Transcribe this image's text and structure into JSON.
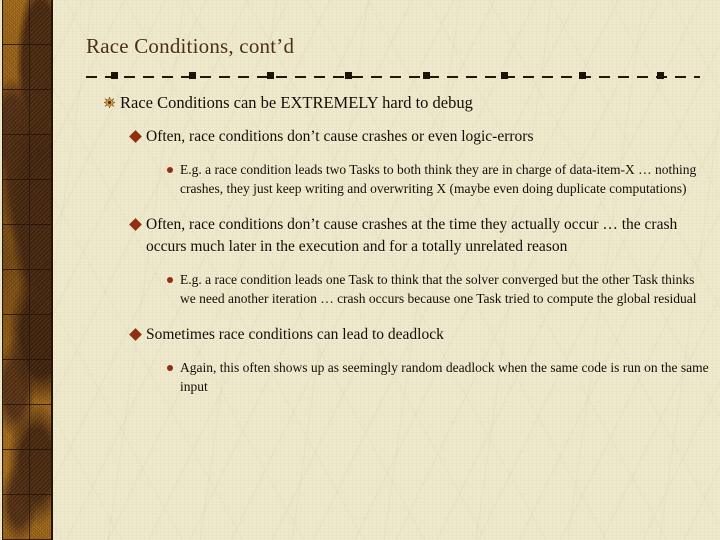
{
  "slide": {
    "title": "Race Conditions, cont’d",
    "background_color": "#ece7c9",
    "title_color": "#4a2f14",
    "body_text_color": "#130b04",
    "accent_color": "#8f3110",
    "band_color": "#a96f1d",
    "rule_color": "#241608"
  },
  "sidebar": {
    "name": "decorative-left-band"
  },
  "bullets": [
    {
      "level": 1,
      "glyph": "star-bullet-icon",
      "text": "Race Conditions can be EXTREMELY hard to debug"
    },
    {
      "level": 2,
      "glyph": "diamond-bullet-icon",
      "text": "Often, race conditions don’t cause crashes or even logic-errors"
    },
    {
      "level": 3,
      "glyph": "dot-bullet-icon",
      "text": "E.g. a race condition leads two Tasks to both think they are in charge of data-item-X … nothing crashes, they just keep writing and overwriting X (maybe even doing duplicate computations)"
    },
    {
      "level": 2,
      "glyph": "diamond-bullet-icon",
      "text": "Often, race conditions don’t cause crashes at the time they actually occur … the crash occurs much later in the execution and for a totally unrelated reason"
    },
    {
      "level": 3,
      "glyph": "dot-bullet-icon",
      "text": "E.g. a race condition leads one Task to think that the solver converged but the other Task thinks we need another iteration … crash occurs because one Task tried to compute the global residual"
    },
    {
      "level": 2,
      "glyph": "diamond-bullet-icon",
      "text": "Sometimes race conditions can lead to deadlock"
    },
    {
      "level": 3,
      "glyph": "dot-bullet-icon",
      "text": "Again, this often shows up as seemingly random deadlock when the same code is run on the same input"
    }
  ]
}
